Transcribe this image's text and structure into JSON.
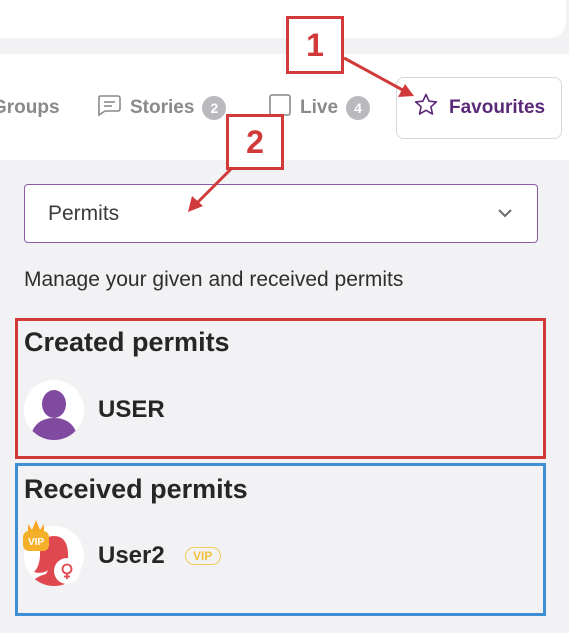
{
  "tabs": [
    {
      "label": "Groups",
      "icon": "groups-icon"
    },
    {
      "label": "Stories",
      "badge": "2",
      "icon": "stories-icon"
    },
    {
      "label": "Live",
      "badge": "4",
      "icon": "live-icon"
    },
    {
      "label": "Favourites",
      "icon": "star-icon"
    }
  ],
  "permits_select": {
    "value": "Permits",
    "icon": "chevron-down-icon"
  },
  "description": "Manage your given and received permits",
  "created_section": {
    "title": "Created permits",
    "users": [
      {
        "name": "USER"
      }
    ]
  },
  "received_section": {
    "title": "Received permits",
    "users": [
      {
        "name": "User2",
        "vip_label": "VIP",
        "avatar_badge": "VIP"
      }
    ]
  },
  "annotations": {
    "step1": "1",
    "step2": "2"
  },
  "colors": {
    "accent_purple": "#5a2a78",
    "select_border": "#8e5aa8",
    "annotation_red": "#d23a3a",
    "annotation_blue": "#3f8fd6",
    "vip_gold": "#f0c040",
    "avatar_female": "#e0484f"
  }
}
